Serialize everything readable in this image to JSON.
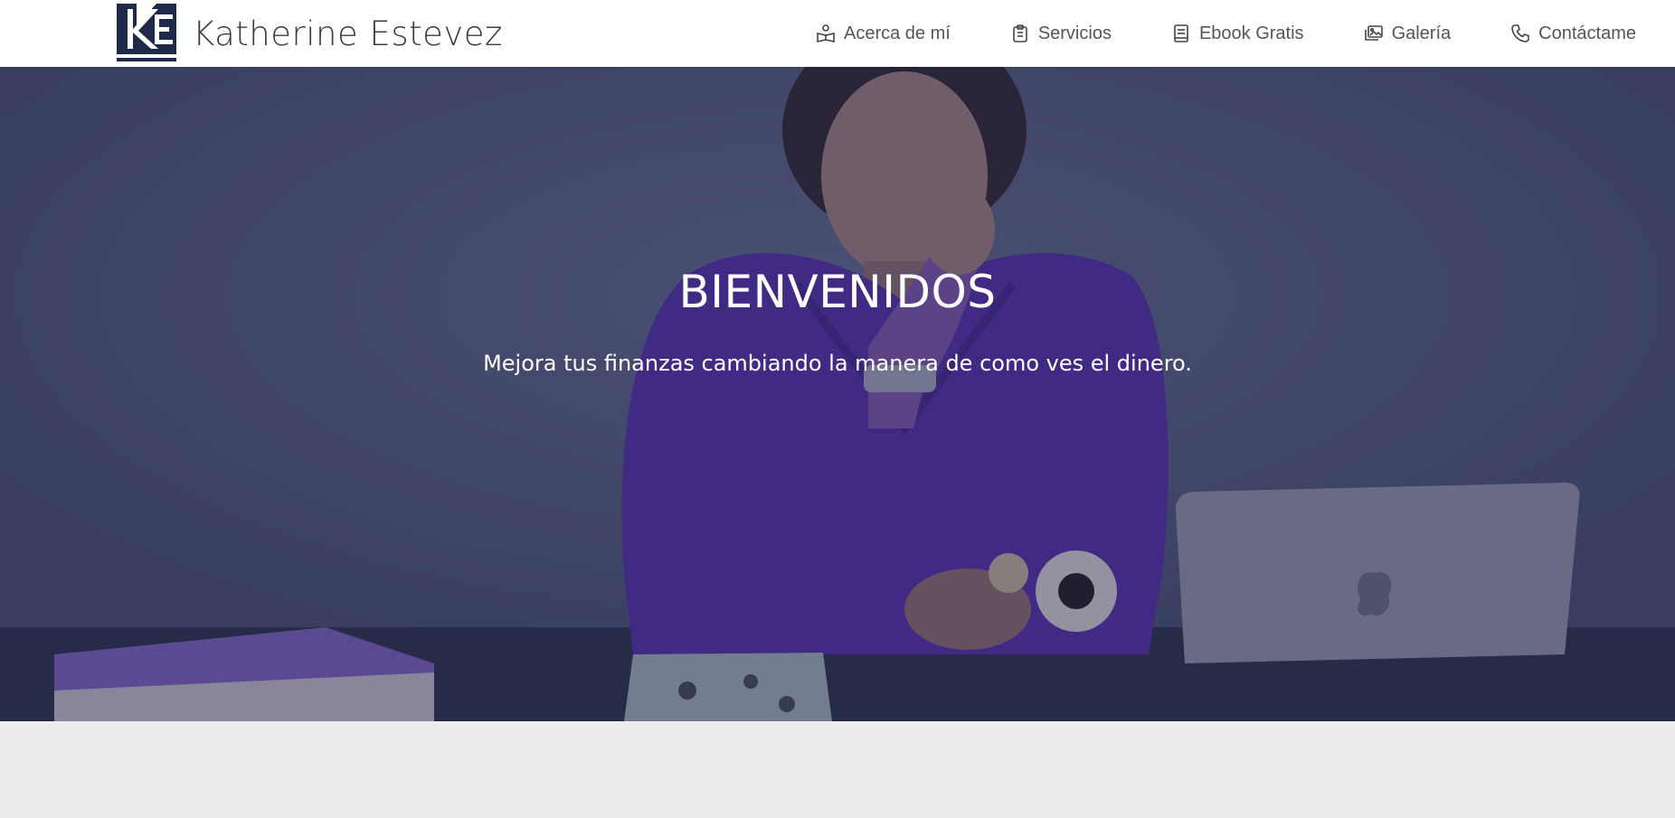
{
  "brand": {
    "name": "Katherine Estevez",
    "logo_initials": "KE",
    "logo_caption": "KATHERINE ESTEVEZ"
  },
  "nav": {
    "items": [
      {
        "label": "Acerca de mí",
        "icon": "person-book-icon"
      },
      {
        "label": "Servicios",
        "icon": "clipboard-icon"
      },
      {
        "label": "Ebook Gratis",
        "icon": "book-icon"
      },
      {
        "label": "Galería",
        "icon": "images-icon"
      },
      {
        "label": "Contáctame",
        "icon": "phone-icon"
      }
    ]
  },
  "hero": {
    "title": "BIENVENIDOS",
    "subtitle": "Mejora tus finanzas cambiando la manera de como ves el dinero."
  },
  "colors": {
    "navbar_bg": "#ffffff",
    "hero_tint": "#444b6c",
    "jacket_purple": "#5a2fb0",
    "page_bg": "#efecf0",
    "logo_navy": "#1f2a4a"
  }
}
